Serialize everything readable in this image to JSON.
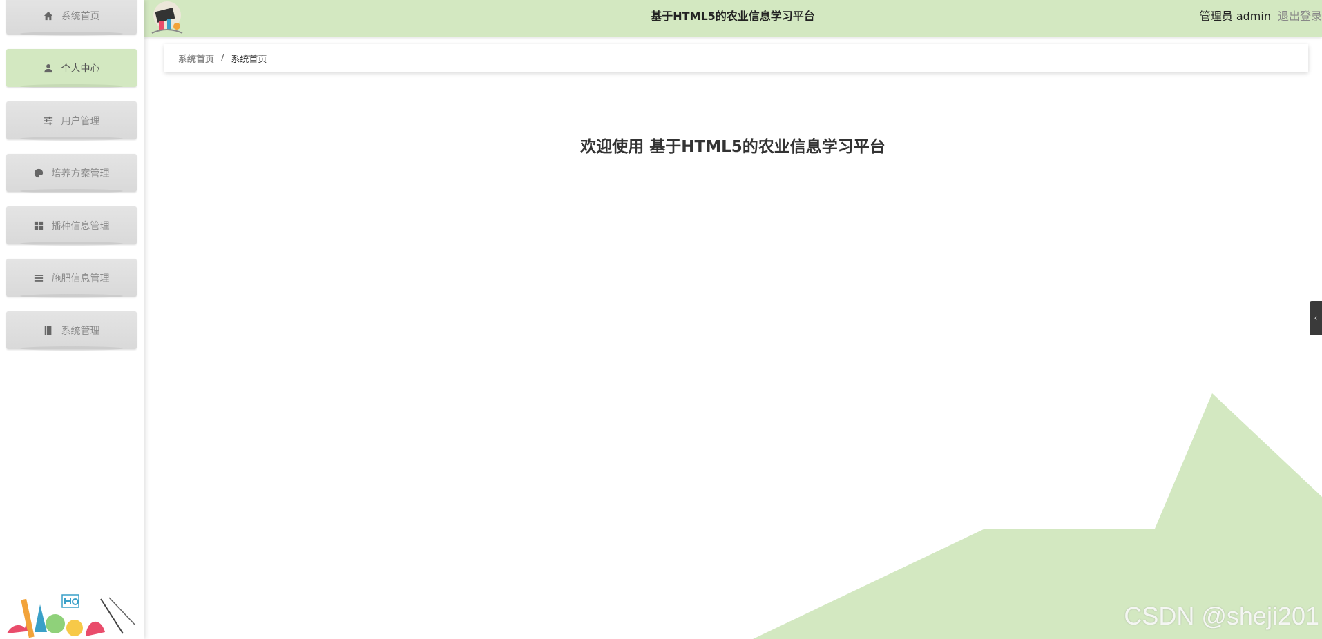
{
  "header": {
    "title": "基于HTML5的农业信息学习平台",
    "user_label": "管理员 admin",
    "logout_label": "退出登录"
  },
  "sidebar": {
    "items": [
      {
        "label": "系统首页",
        "icon": "home-icon"
      },
      {
        "label": "个人中心",
        "icon": "person-icon",
        "active": true
      },
      {
        "label": "用户管理",
        "icon": "sliders-icon"
      },
      {
        "label": "培养方案管理",
        "icon": "palette-icon"
      },
      {
        "label": "播种信息管理",
        "icon": "grid-icon"
      },
      {
        "label": "施肥信息管理",
        "icon": "list-icon"
      },
      {
        "label": "系统管理",
        "icon": "book-icon"
      }
    ]
  },
  "breadcrumb": {
    "first": "系统首页",
    "separator": "/",
    "current": "系统首页"
  },
  "main": {
    "welcome": "欢迎使用 基于HTML5的农业信息学习平台"
  },
  "side_handle": {
    "glyph": "‹"
  },
  "watermark": "CSDN @sheji201",
  "colors": {
    "accent_green": "#d3e8c1",
    "menu_gray": "#dcdcdc",
    "handle_dark": "#3a3a3a"
  }
}
